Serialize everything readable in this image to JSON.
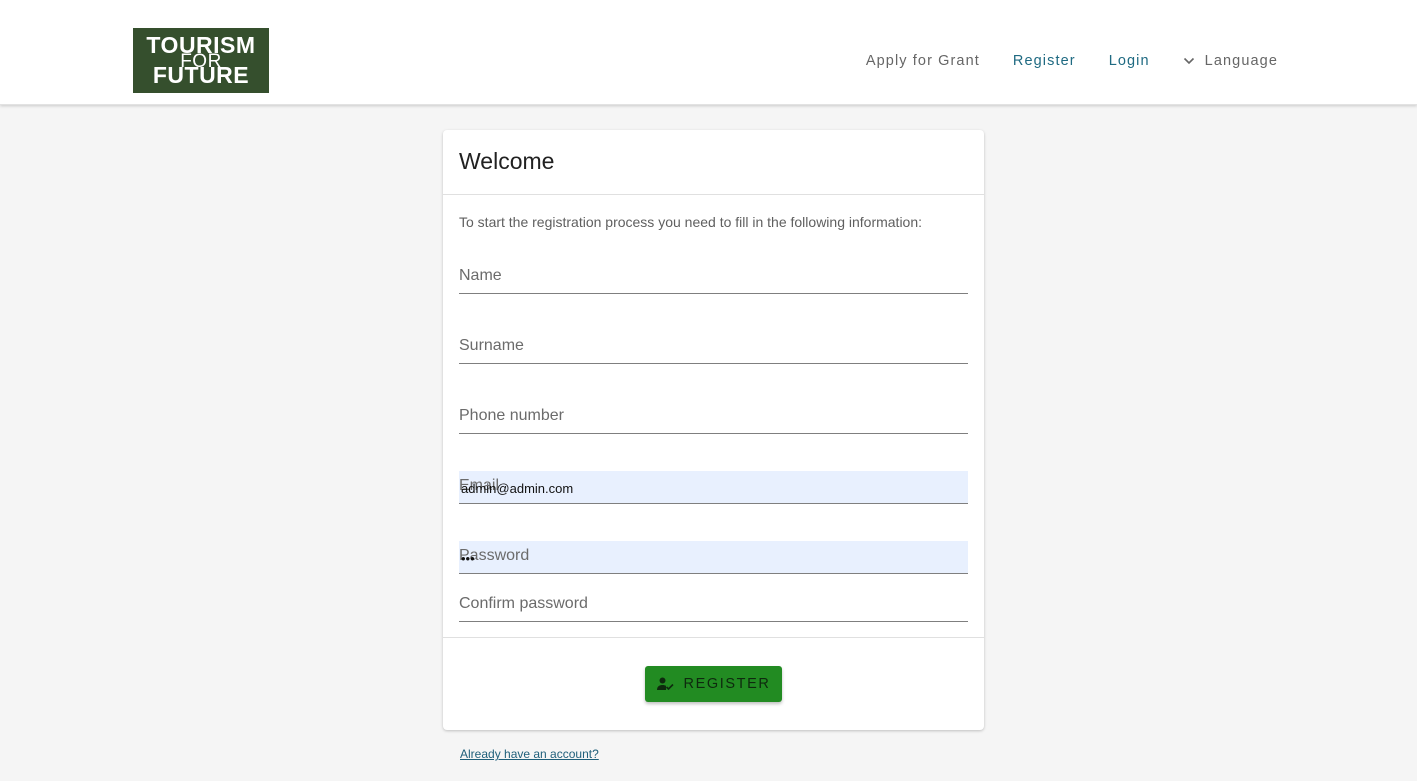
{
  "header": {
    "logo": {
      "line1": "TOURISM",
      "line2": "FOR",
      "line3": "FUTURE"
    },
    "nav": {
      "apply": "Apply for Grant",
      "register": "Register",
      "login": "Login",
      "language": "Language"
    }
  },
  "form": {
    "title": "Welcome",
    "intro": "To start the registration process you need to fill in the following information:",
    "fields": {
      "name": {
        "label": "Name",
        "value": ""
      },
      "surname": {
        "label": "Surname",
        "value": ""
      },
      "phone": {
        "label": "Phone number",
        "value": ""
      },
      "email": {
        "label": "Email",
        "value": "admin@admin.com"
      },
      "password": {
        "label": "Password",
        "value": "•••"
      },
      "confirm": {
        "label": "Confirm password",
        "value": ""
      }
    },
    "register_button": "REGISTER",
    "account_link": "Already have an account?"
  },
  "colors": {
    "logo_bg": "#354f2d",
    "button_bg": "#228b22",
    "link": "#1f6a82",
    "autofill_bg": "#e8f0fe"
  }
}
